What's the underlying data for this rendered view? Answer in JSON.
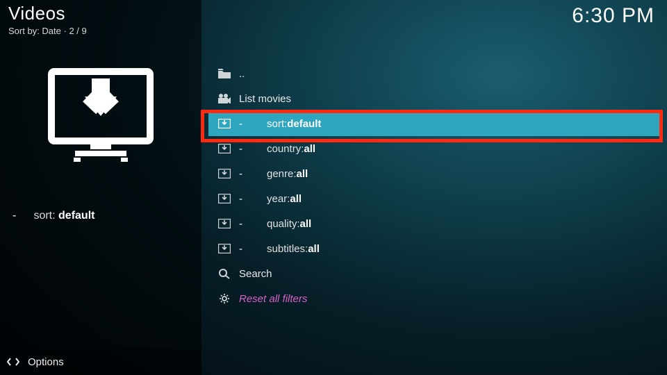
{
  "header": {
    "title": "Videos",
    "sort_prefix": "Sort by: ",
    "sort_field": "Date",
    "separator": "  ·  ",
    "position": "2 / 9"
  },
  "clock": "6:30 PM",
  "sidebar": {
    "detail_prefix": "-",
    "detail_key": "sort: ",
    "detail_val": "default"
  },
  "list": {
    "up_label": "..",
    "item1": "List movies",
    "filter_dash": "-",
    "sort_key": "sort: ",
    "sort_val": "default",
    "country_key": "country: ",
    "country_val": "all",
    "genre_key": "genre: ",
    "genre_val": "all",
    "year_key": "year: ",
    "year_val": "all",
    "quality_key": "quality: ",
    "quality_val": "all",
    "subtitles_key": "subtitles: ",
    "subtitles_val": "all",
    "search": "Search",
    "reset": "Reset all filters"
  },
  "footer": {
    "options": "Options"
  }
}
